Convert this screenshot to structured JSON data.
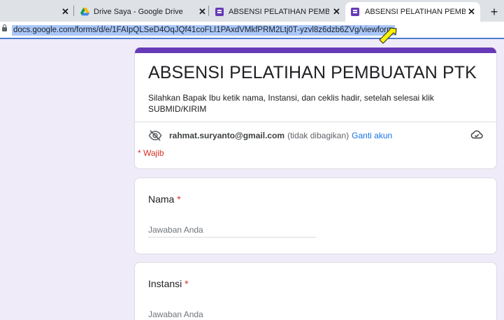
{
  "browser": {
    "tabs": [
      {
        "label": "",
        "active": false
      },
      {
        "label": "Drive Saya - Google Drive",
        "active": false
      },
      {
        "label": "ABSENSI PELATIHAN PEMBUATAN",
        "active": false
      },
      {
        "label": "ABSENSI PELATIHAN PEMBUATAN",
        "active": true
      }
    ],
    "close_glyph": "✕",
    "new_tab_glyph": "+",
    "url": "docs.google.com/forms/d/e/1FAIpQLSeD4OqJQf41coFLI1PAxdVMkfPRM2Ltj0T-yzvl8z6dzb6ZVg/viewform"
  },
  "form": {
    "accent_color": "#673ab7",
    "title": "ABSENSI PELATIHAN PEMBUATAN PTK",
    "description": "Silahkan Bapak Ibu ketik nama, Instansi, dan ceklis hadir, setelah selesai klik SUBMID/KIRIM",
    "account": {
      "email": "rahmat.suryanto@gmail.com",
      "not_shared": "(tidak dibagikan)",
      "switch_label": "Ganti akun"
    },
    "required_note": "* Wajib",
    "questions": [
      {
        "label": "Nama",
        "required_mark": "*",
        "placeholder": "Jawaban Anda"
      },
      {
        "label": "Instansi",
        "required_mark": "*",
        "placeholder": "Jawaban Anda"
      }
    ]
  },
  "icons": [
    "lock-icon",
    "google-drive-icon",
    "google-forms-icon",
    "eye-off-icon",
    "cloud-icon",
    "pointer-arrow-icon"
  ]
}
